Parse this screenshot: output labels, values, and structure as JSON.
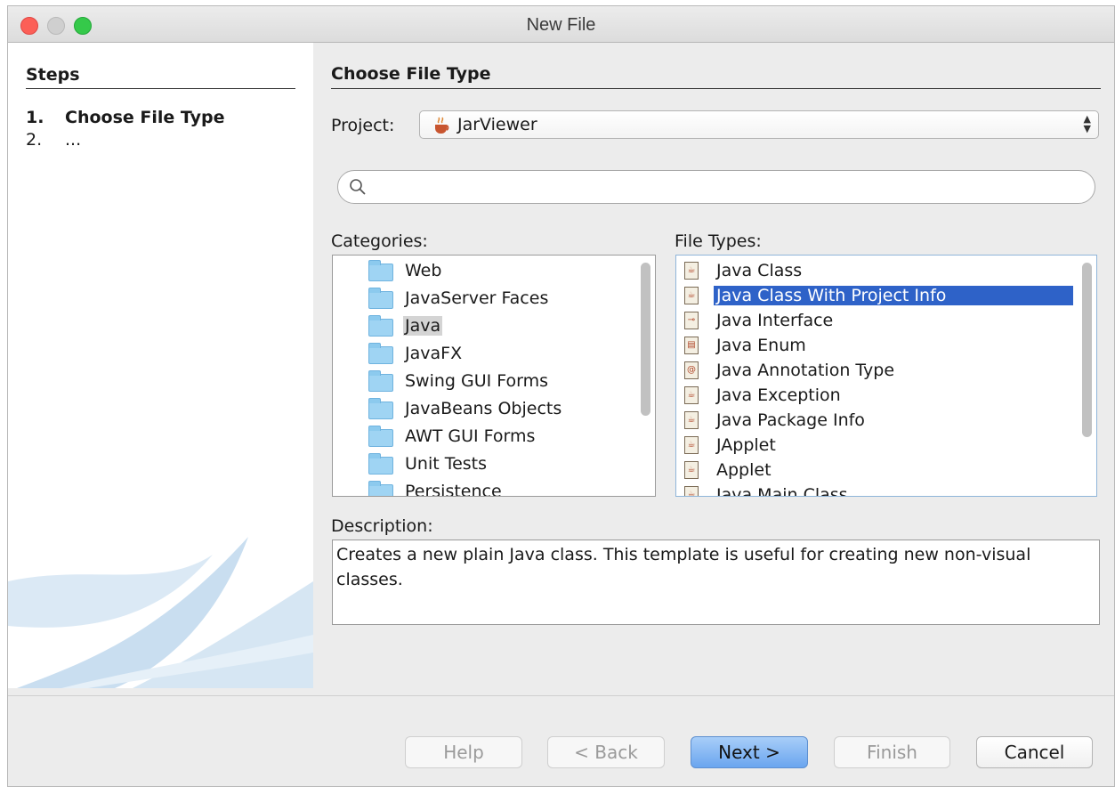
{
  "window": {
    "title": "New File"
  },
  "steps": {
    "heading": "Steps",
    "items": [
      {
        "num": "1.",
        "label": "Choose File Type"
      },
      {
        "num": "2.",
        "label": "..."
      }
    ]
  },
  "main": {
    "heading": "Choose File Type",
    "project_label": "Project:",
    "project_value": "JarViewer",
    "search": {
      "placeholder": ""
    },
    "categories_label": "Categories:",
    "categories": [
      "Web",
      "JavaServer Faces",
      "Java",
      "JavaFX",
      "Swing GUI Forms",
      "JavaBeans Objects",
      "AWT GUI Forms",
      "Unit Tests",
      "Persistence"
    ],
    "selected_category": "Java",
    "file_types_label": "File Types:",
    "file_types": [
      "Java Class",
      "Java Class With Project Info",
      "Java Interface",
      "Java Enum",
      "Java Annotation Type",
      "Java Exception",
      "Java Package Info",
      "JApplet",
      "Applet",
      "Java Main Class"
    ],
    "selected_file_type": "Java Class With Project Info",
    "description_label": "Description:",
    "description": "Creates a new plain Java class. This template is useful for creating new non-visual classes."
  },
  "buttons": {
    "help": "Help",
    "back": "< Back",
    "next": "Next >",
    "finish": "Finish",
    "cancel": "Cancel"
  },
  "colors": {
    "selection": "#2e62c8",
    "primary_button": "#6aa5ef",
    "folder": "#9fd4f3"
  }
}
